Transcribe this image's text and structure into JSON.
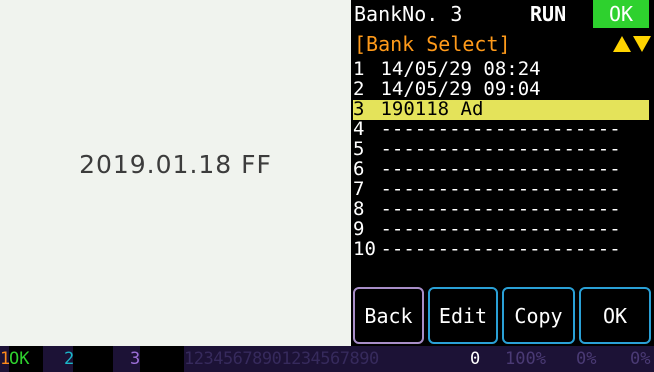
{
  "preview": {
    "text": "2019.01.18 FF"
  },
  "header": {
    "bank_no": "BankNo. 3",
    "run": "RUN",
    "ok": "OK",
    "bank_select": "[Bank Select]"
  },
  "list": [
    {
      "num": "1",
      "value": "14/05/29 08:24",
      "selected": false
    },
    {
      "num": "2",
      "value": "14/05/29 09:04",
      "selected": false
    },
    {
      "num": "3",
      "value": "190118 Ad",
      "selected": true
    },
    {
      "num": "4",
      "value": "---------------------",
      "selected": false
    },
    {
      "num": "5",
      "value": "---------------------",
      "selected": false
    },
    {
      "num": "6",
      "value": "---------------------",
      "selected": false
    },
    {
      "num": "7",
      "value": "---------------------",
      "selected": false
    },
    {
      "num": "8",
      "value": "---------------------",
      "selected": false
    },
    {
      "num": "9",
      "value": "---------------------",
      "selected": false
    },
    {
      "num": "10",
      "value": "---------------------",
      "selected": false
    }
  ],
  "buttons": {
    "back": "Back",
    "edit": "Edit",
    "copy": "Copy",
    "ok": "OK"
  },
  "status": {
    "s1_num": "1",
    "s1_val": "OK",
    "s2_num": "2",
    "s2_val": "",
    "s3_num": "3",
    "s3_val": "",
    "digits": "12345678901234567890",
    "count": "0",
    "pct1": "100%",
    "pct2": "0%",
    "pct3": "0%"
  },
  "colors": {
    "ok_badge": "#2ed12e",
    "bank_select": "#ff9a1a",
    "selected_row": "#e4e35a",
    "button_border": "#2aa0d6"
  }
}
